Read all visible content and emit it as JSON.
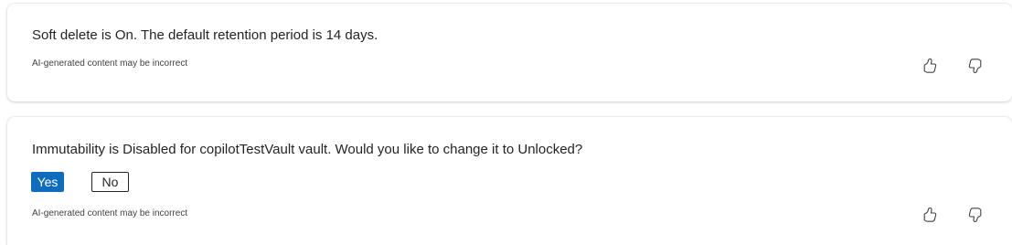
{
  "messages": [
    {
      "text": "Soft delete is On. The default retention period is 14 days.",
      "disclaimer": "AI-generated content may be incorrect",
      "feedback": {
        "like_icon": "thumb-up-icon",
        "dislike_icon": "thumb-down-icon"
      }
    },
    {
      "text": "Immutability is Disabled for copilotTestVault vault. Would you like to change it to Unlocked?",
      "buttons": {
        "yes": "Yes",
        "no": "No"
      },
      "disclaimer": "AI-generated content may be incorrect",
      "feedback": {
        "like_icon": "thumb-up-icon",
        "dislike_icon": "thumb-down-icon"
      }
    }
  ],
  "colors": {
    "primary_button": "#0f6cbd",
    "text": "#242424",
    "card_background": "#ffffff"
  }
}
